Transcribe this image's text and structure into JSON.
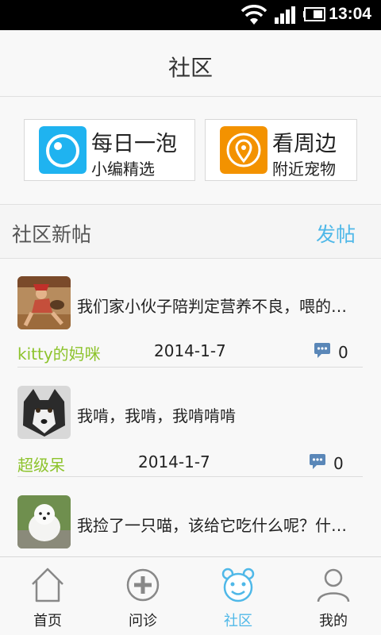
{
  "status_bar": {
    "time": "13:04"
  },
  "header": {
    "title": "社区"
  },
  "features": [
    {
      "name": "每日一泡",
      "sub": "小编精选",
      "icon": "bubble-icon",
      "color": "#1fb3f0"
    },
    {
      "name": "看周边",
      "sub": "附近宠物",
      "icon": "location-pin-icon",
      "color": "#f39200"
    }
  ],
  "section": {
    "title": "社区新帖",
    "action": "发帖"
  },
  "posts": [
    {
      "text": "我们家小伙子陪判定营养不良，喂的…",
      "author": "kitty的妈咪",
      "date": "2014-1-7",
      "comments": "0"
    },
    {
      "text": "我啃，我啃，我啃啃啃",
      "author": "超级呆",
      "date": "2014-1-7",
      "comments": "0"
    },
    {
      "text": "我捡了一只喵，该给它吃什么呢？什…",
      "author": "",
      "date": "",
      "comments": ""
    }
  ],
  "tabs": [
    {
      "label": "首页",
      "icon": "home-icon"
    },
    {
      "label": "问诊",
      "icon": "plus-circle-icon"
    },
    {
      "label": "社区",
      "icon": "bear-face-icon",
      "active": true
    },
    {
      "label": "我的",
      "icon": "person-icon"
    }
  ],
  "colors": {
    "accent": "#4fb8e8",
    "author": "#8dc32c"
  }
}
